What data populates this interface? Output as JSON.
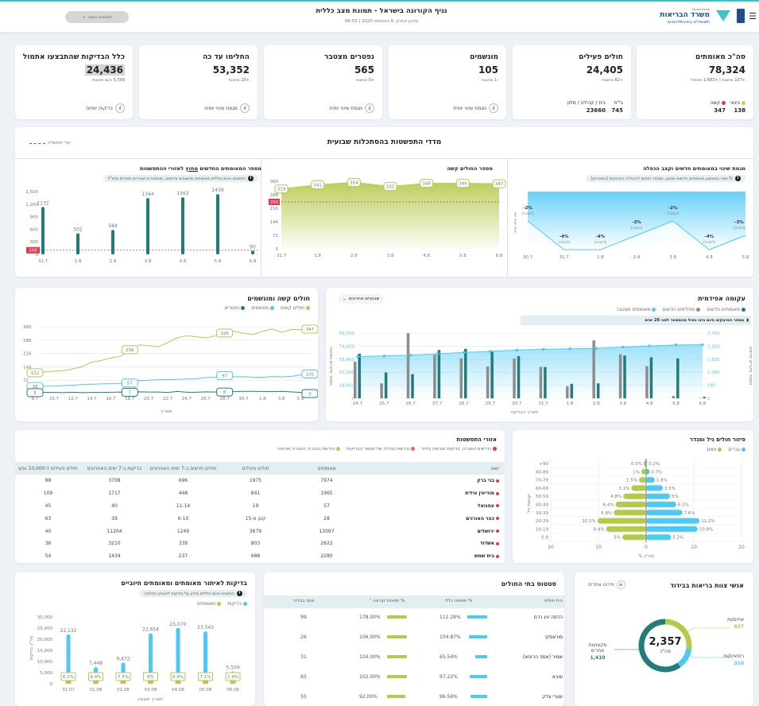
{
  "header": {
    "title": "נגיף הקורונה בישראל - תמונת מצב כללית",
    "updated": "עדכון אחרון: 6 באוגוסט 2020 | 06:52",
    "back_button": "לתמונת המצב",
    "logo": {
      "state": "מדינת ישראל",
      "ministry": "משרד הבריאות",
      "english": "Israel Ministry of Health"
    }
  },
  "kpis": [
    {
      "title": "סה\"כ מאומתים",
      "value": "78,324",
      "sub": "+107 מחצות | +1,683 אתמול",
      "breakdown": [
        {
          "label": "בינוני",
          "value": "138",
          "color": "#c8d44a"
        },
        {
          "label": "קשה",
          "value": "347",
          "color": "#e8354a"
        }
      ]
    },
    {
      "title": "חולים פעילים",
      "value": "24,405",
      "sub": "+82 מחצות",
      "breakdown": [
        {
          "label": "בי\"ח",
          "value": "745"
        },
        {
          "label": "בית / קהילה / מלון",
          "value": "23660"
        }
      ]
    },
    {
      "title": "מונשמים",
      "value": "105",
      "sub": "-1 מחצות",
      "footer": "מגמת שינוי יומית"
    },
    {
      "title": "נפטרים מצטבר",
      "value": "565",
      "sub": "+0 מחצות",
      "footer": "מגמת שינוי יומית"
    },
    {
      "title": "החלימו עד כה",
      "value": "53,352",
      "sub": "+25 מחצות",
      "footer": "מגמת שינוי יומית"
    },
    {
      "title": "כלל הבדיקות שהתבצעו אתמול",
      "value": "24,436",
      "sub": "5,599 היום מחצות",
      "footer": "בדיקות יומיות"
    }
  ],
  "weekly": {
    "title": "מדדי התפשטות בהסתכלות שבועית",
    "target_legend": "יעדי ממשלה",
    "outside": {
      "title_pre": "מספר המאומתים החדשים ",
      "title_u": "מחוץ",
      "title_post": " לאזורי ההתפשטות",
      "note": "הנתונים אינם כוללים מאומתים מיישובים אדומים, תוספות גריאטריים וחוזרים מחו\"ל"
    },
    "severe": {
      "title": "מספר החולים קשה"
    },
    "trend": {
      "title": "מגמת שינוי במאומתים חדשים וקצב הכפלה",
      "note": "% שינוי בממוצע מאומתים חדשים שבועי, ומספר הימים להכפלה הנדבקים (בסוגריים)"
    }
  },
  "severe_card": {
    "title": "חולים קשה ומונשמים",
    "legend": [
      "חולים קשים",
      "מונשמים",
      "נפטרים"
    ],
    "xlabel": "תאריך"
  },
  "epi_card": {
    "title": "עקומה אפידמית",
    "dropdown": "שבועיים אחרונים",
    "legend": [
      "מאומתים חדשים",
      "מחלימים חדשים",
      "מאומתים מצטבר"
    ],
    "note": "מספר הנדבקים היום הינו כפול מהמספר לפני 26 ימים"
  },
  "areas": {
    "title": "אזורי התפשטות",
    "legend": [
      {
        "label": "נדרשים הסברה, בדיקות ואכיפת בידוד",
        "color": "#e8354a"
      },
      {
        "label": "נדרשת הגדלה של מספר הבדיקות",
        "color": "#e86a5a"
      },
      {
        "label": "נדרשת הגברת, הסברה ואכיפה",
        "color": "#c8c44a"
      }
    ],
    "columns": [
      "ישוב",
      "מאומתים",
      "חולים פעילים",
      "חולים חדשים ב-7 ימים האחרונים",
      "בדיקות ב-7 ימים האחרונים",
      "חולים פעילים ל-10,000 נפש"
    ],
    "rows": [
      [
        "בני ברק",
        "7974",
        "1975",
        "696",
        "3708",
        "98"
      ],
      [
        "מודיעין עילית",
        "1965",
        "841",
        "448",
        "1717",
        "109"
      ],
      [
        "עמנואל",
        "57",
        "19",
        "11-14",
        "40",
        "45"
      ],
      [
        "כפר האורנים",
        "28",
        "קטן מ-15",
        "6-10",
        "39",
        "63"
      ],
      [
        "ירושלים",
        "13097",
        "3679",
        "1249",
        "11204",
        "40"
      ],
      [
        "אשדוד",
        "2622",
        "803",
        "339",
        "3210",
        "36"
      ],
      [
        "בית שמש",
        "2280",
        "688",
        "237",
        "1434",
        "54"
      ]
    ]
  },
  "pyramid_card": {
    "title": "פיזור חולים גיל ומגדר",
    "legend": [
      "גברים",
      "נשים"
    ]
  },
  "tests_card": {
    "title": "בדיקות לאיתור מאומתים ומאומתים חיוביים",
    "note": "הנתונים אינם כוללים מידע על בדיקות לאבחון החלמה",
    "legend": [
      "בדיקות",
      "מאומתים"
    ]
  },
  "hospitals": {
    "title": "סטטוס בתי החולים",
    "columns": [
      "בית חולים",
      "% תפוסה כללי",
      "% תפוסת קורונה ˄",
      "צוות בבידוד"
    ],
    "rows": [
      {
        "name": "הדסה עין כרם",
        "general": "112.28%",
        "general_v": 112.28,
        "corona": "178.00%",
        "corona_v": 178,
        "staff": "99"
      },
      {
        "name": "סוראסקי",
        "general": "104.87%",
        "general_v": 104.87,
        "corona": "106.00%",
        "corona_v": 106,
        "staff": "26"
      },
      {
        "name": "שמיר (אסף הרופא)",
        "general": "65.54%",
        "general_v": 65.54,
        "corona": "104.00%",
        "corona_v": 104,
        "staff": "31"
      },
      {
        "name": "שיבא",
        "general": "97.22%",
        "general_v": 97.22,
        "corona": "102.00%",
        "corona_v": 102,
        "staff": "65"
      },
      {
        "name": "שערי צדק",
        "general": "96.56%",
        "general_v": 96.56,
        "corona": "92.00%",
        "corona_v": 92,
        "staff": "55"
      }
    ]
  },
  "staff": {
    "title": "אנשי צוות בריאות בבידוד",
    "button": "פירוט אחרים",
    "total": "2,357",
    "total_label": "סה\"כ",
    "segments": [
      {
        "label": "אחים/ות",
        "value": 637,
        "display": "637",
        "color": "#b5c94a"
      },
      {
        "label": "רופאים/ות",
        "value": 310,
        "display": "310",
        "color": "#4dc9f6"
      },
      {
        "label": "מקצועות אחרים",
        "value": 1410,
        "display": "1,410",
        "color": "#227c7a"
      }
    ]
  },
  "colors": {
    "teal": "#227c7a",
    "blue": "#4dc9f6",
    "green": "#b5c94a",
    "red": "#e8354a",
    "gray": "#8c8c8c"
  },
  "chart_data": [
    {
      "type": "bar",
      "id": "outside",
      "categories": [
        "31.7",
        "1.8",
        "2.8",
        "3.8",
        "4.8",
        "5.8",
        "6.8"
      ],
      "values": [
        1132,
        502,
        584,
        1344,
        1363,
        1439,
        90
      ],
      "ylim": [
        0,
        1500
      ],
      "yticks": [
        0,
        300,
        600,
        900,
        1200,
        1500
      ],
      "target": 100
    },
    {
      "type": "area",
      "id": "severe",
      "categories": [
        "31.7",
        "1.8",
        "2.8",
        "3.8",
        "4.8",
        "5.8",
        "6.8"
      ],
      "values": [
        319,
        341,
        354,
        332,
        349,
        349,
        347
      ],
      "ylim": [
        0,
        360
      ],
      "yticks": [
        0,
        72,
        144,
        216,
        288,
        360
      ],
      "target": 250
    },
    {
      "type": "line",
      "id": "trend",
      "categories": [
        "30.7",
        "31.7",
        "1.8",
        "2.8",
        "3.8",
        "4.8",
        "5.8"
      ],
      "values": [
        -2,
        -4,
        -4,
        -3,
        -2,
        -4,
        -3
      ],
      "value_labels": [
        "-2%",
        "-4%",
        "-4%",
        "-3%",
        "-2%",
        "-4%",
        "-3%"
      ],
      "sub_label": "(דעיכה)",
      "ylabel": "אחוז שינוי יומי"
    },
    {
      "type": "line",
      "id": "severe_vent",
      "categories": [
        "8.7",
        "9.7",
        "10.7",
        "11.7",
        "12.7",
        "13.7",
        "14.7",
        "15.7",
        "16.7",
        "17.7",
        "18.7",
        "19.7",
        "20.7",
        "21.7",
        "22.7",
        "23.7",
        "24.7",
        "25.7",
        "26.7",
        "27.7",
        "28.7",
        "29.7",
        "30.7",
        "31.7",
        "1.8",
        "2.8",
        "3.8",
        "4.8",
        "5.8",
        "6.8"
      ],
      "xticks": [
        "8.7",
        "10.7",
        "12.7",
        "14.7",
        "16.7",
        "18.7",
        "20.7",
        "22.7",
        "24.7",
        "26.7",
        "28.7",
        "30.7",
        "1.8",
        "3.8",
        "5.8"
      ],
      "series": [
        {
          "name": "חולים קשים",
          "values": [
            112,
            116,
            120,
            124,
            133,
            145,
            170,
            178,
            192,
            200,
            236,
            262,
            258,
            252,
            275,
            300,
            312,
            306,
            300,
            310,
            326,
            336,
            325,
            318,
            335,
            348,
            330,
            345,
            345,
            347
          ]
        },
        {
          "name": "מונשמים",
          "values": [
            38,
            39,
            40,
            43,
            45,
            48,
            50,
            52,
            53,
            55,
            57,
            70,
            72,
            74,
            75,
            76,
            78,
            80,
            86,
            88,
            97,
            90,
            91,
            88,
            88,
            91,
            90,
            92,
            100,
            105
          ]
        },
        {
          "name": "נפטרים",
          "values": [
            5,
            6,
            6,
            5,
            7,
            5,
            6,
            6,
            7,
            8,
            7,
            9,
            8,
            8,
            6,
            11,
            7,
            7,
            9,
            8,
            8,
            10,
            12,
            12,
            11,
            10,
            12,
            9,
            6,
            0
          ]
        }
      ],
      "labeled_points": [
        0,
        10,
        20,
        29
      ],
      "ylim": [
        0,
        360
      ],
      "yticks": [
        72,
        144,
        216,
        288,
        360
      ],
      "xlabel": "תאריך"
    },
    {
      "type": "bar+line",
      "id": "epi",
      "categories": [
        "24.7",
        "25.7",
        "26.7",
        "27.7",
        "28.7",
        "29.7",
        "30.7",
        "31.7",
        "1.8",
        "2.8",
        "3.8",
        "4.8",
        "5.8",
        "6.8"
      ],
      "series": [
        {
          "name": "מחלימים חדשים",
          "axis": "right",
          "values": [
            1520,
            620,
            2700,
            1800,
            1650,
            1320,
            1650,
            1300,
            500,
            2400,
            1820,
            1330,
            100,
            10
          ]
        },
        {
          "name": "מאומתים חדשים",
          "axis": "right",
          "values": [
            1850,
            1070,
            1000,
            2000,
            2050,
            1930,
            1750,
            1300,
            600,
            620,
            1770,
            1700,
            1650,
            60
          ]
        },
        {
          "name": "מאומתים מצטבר",
          "axis": "left",
          "values": [
            59500,
            60400,
            61600,
            63500,
            65300,
            67000,
            68800,
            69900,
            70600,
            71300,
            73100,
            74700,
            76200,
            76400
          ]
        }
      ],
      "ylim_left": [
        0,
        93000
      ],
      "yticks_left": [
        "0",
        "18,600",
        "37,200",
        "55,800",
        "74,400",
        "93,000"
      ],
      "ylim_right": [
        0,
        2700
      ],
      "yticks_right": [
        "0",
        "540",
        "1,080",
        "1,620",
        "2,160",
        "2,700"
      ],
      "ylabel_left": "מספר מקרים מצטבר",
      "ylabel_right": "מספר מקרים חדשים",
      "xlabel": "תאריך הבדיקה"
    },
    {
      "type": "bar",
      "id": "pyramid",
      "categories": [
        "+90",
        "80-89",
        "70-79",
        "60-69",
        "50-59",
        "40-49",
        "30-39",
        "20-29",
        "10-19",
        "0-9"
      ],
      "series": [
        {
          "name": "נשים",
          "values": [
            0.5,
            1,
            1.5,
            3.1,
            4.8,
            6.4,
            6.8,
            10.2,
            8.4,
            5
          ]
        },
        {
          "name": "גברים",
          "values": [
            0.2,
            0.7,
            1.8,
            3.5,
            5,
            6.3,
            7.6,
            11.2,
            10.8,
            5.2
          ]
        }
      ],
      "xlim": [
        -20,
        20
      ],
      "xticks": [
        "20",
        "10",
        "0",
        "10",
        "20"
      ],
      "xlabel": "% סה\"כ",
      "ylabel": "קבוצת גיל"
    },
    {
      "type": "bar",
      "id": "tests",
      "categories": [
        "31.07",
        "01.08",
        "02.08",
        "03.08",
        "04.08",
        "05.08",
        "06.08"
      ],
      "values": [
        22132,
        7448,
        9472,
        22654,
        25070,
        23543,
        5509
      ],
      "value_labels": [
        "22,132",
        "7,448",
        "9,472",
        "22,654",
        "25,070",
        "23,543",
        "5,509"
      ],
      "positive_pct": [
        "6.1%",
        "8.4%",
        "7.5%",
        "8%",
        "6.9%",
        "7.1%",
        "1.9%"
      ],
      "positive_pct_v": [
        6.1,
        8.4,
        7.5,
        8,
        6.9,
        7.1,
        1.9
      ],
      "ylim": [
        0,
        30000
      ],
      "yticks": [
        "0",
        "5,000",
        "10,000",
        "15,000",
        "20,000",
        "25,000",
        "30,000"
      ],
      "ylabel": "סה\"כ בדיקות",
      "xlabel": "תאריך תוצאה"
    }
  ]
}
